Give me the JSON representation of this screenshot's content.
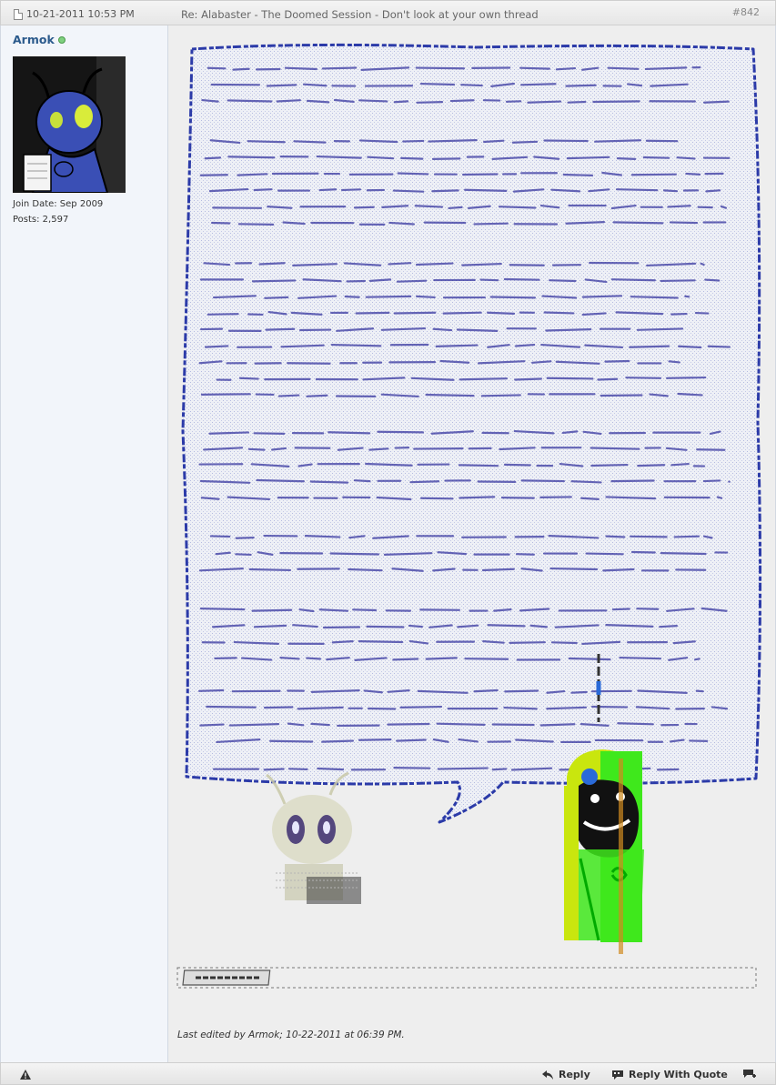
{
  "post": {
    "date": "10-21-2011 10:53 PM",
    "title": "Re: Alabaster - The Doomed Session - Don't look at your own thread",
    "number": "#842",
    "last_edited": "Last edited by Armok; 10-22-2011 at 06:39 PM."
  },
  "user": {
    "name": "Armok",
    "join_date": "Join Date:  Sep 2009",
    "posts": "Posts:  2,597"
  },
  "footer": {
    "reply": "Reply",
    "reply_with_quote": "Reply With Quote"
  },
  "colors": {
    "username": "#2b5a8c",
    "speech_text": "#2a2a9a",
    "speech_border": "#2b3aa8",
    "character_green": "#3fe81c",
    "character_yellow": "#c9e60e"
  }
}
